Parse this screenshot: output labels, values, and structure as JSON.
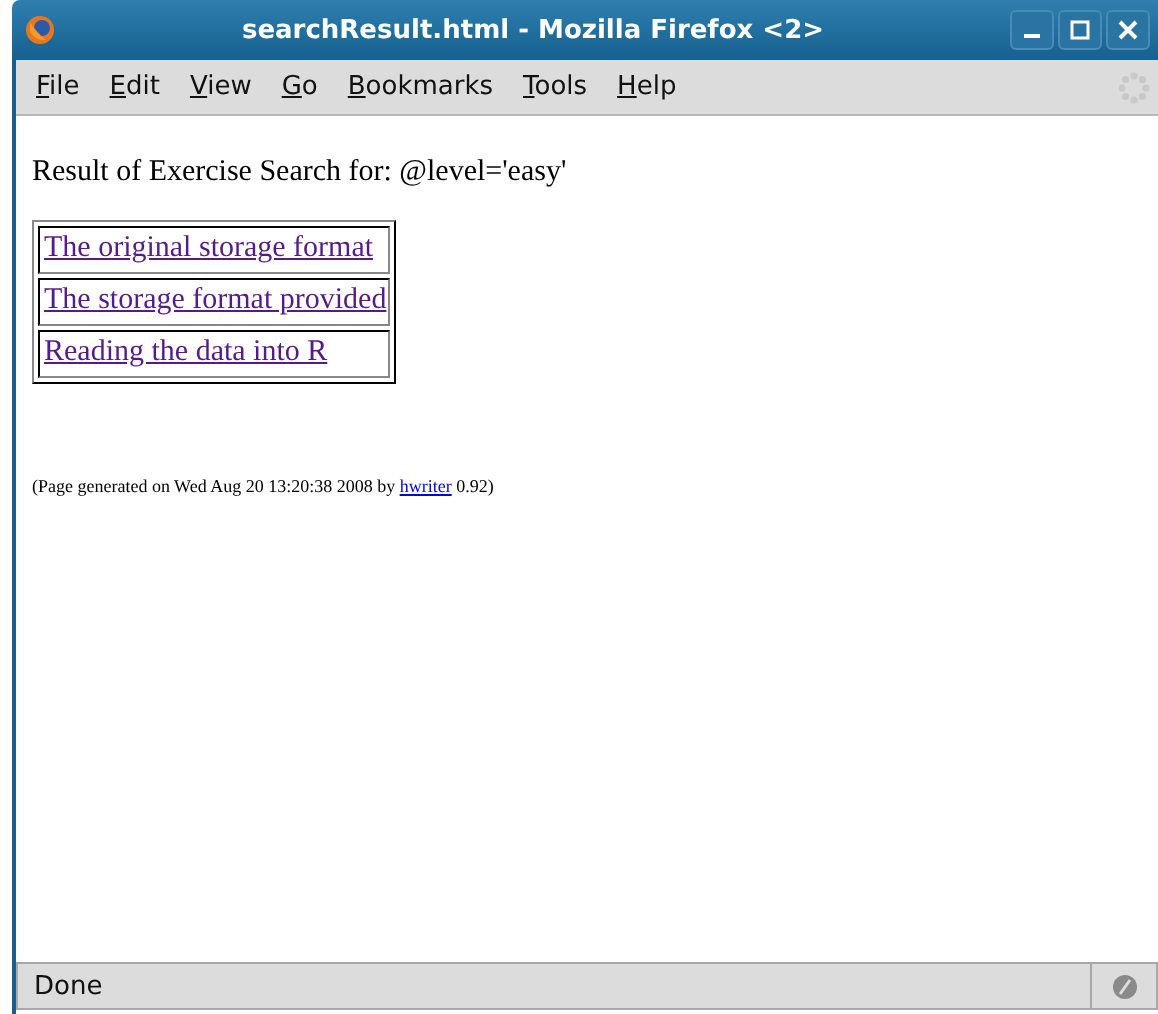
{
  "window": {
    "title": "searchResult.html - Mozilla Firefox <2>"
  },
  "menu": [
    {
      "key": "F",
      "rest": "ile"
    },
    {
      "key": "E",
      "rest": "dit"
    },
    {
      "key": "V",
      "rest": "iew"
    },
    {
      "key": "G",
      "rest": "o"
    },
    {
      "key": "B",
      "rest": "ookmarks"
    },
    {
      "key": "T",
      "rest": "ools"
    },
    {
      "key": "H",
      "rest": "elp"
    }
  ],
  "page": {
    "heading": "Result of Exercise Search for: @level='easy'",
    "results": [
      {
        "label": "The original storage format",
        "visited": true
      },
      {
        "label": "The storage format provided",
        "visited": true
      },
      {
        "label": "Reading the data into R",
        "visited": true
      }
    ],
    "footer": {
      "before": "(Page generated on Wed Aug 20 13:20:38 2008 by ",
      "link": "hwriter",
      "after": " 0.92)"
    }
  },
  "status_bar": {
    "text": "Done"
  }
}
